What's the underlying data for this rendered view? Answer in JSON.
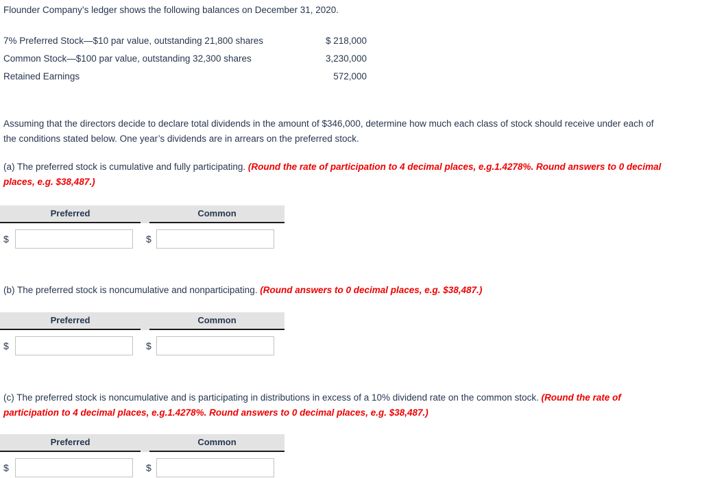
{
  "intro": "Flounder Company’s ledger shows the following balances on December 31, 2020.",
  "ledger": {
    "rows": [
      {
        "label": "7% Preferred Stock—$10 par value, outstanding 21,800 shares",
        "amount": "$ 218,000"
      },
      {
        "label": "Common Stock—$100 par value, outstanding 32,300 shares",
        "amount": "3,230,000"
      },
      {
        "label": "Retained Earnings",
        "amount": "572,000"
      }
    ]
  },
  "assume_paragraph": "Assuming that the directors decide to declare total dividends in the amount of $346,000, determine how much each class of stock should receive under each of the conditions stated below. One year’s dividends are in arrears on the preferred stock.",
  "questions": [
    {
      "letter": "(a)",
      "text": " The preferred stock is cumulative and fully participating. ",
      "hint": "(Round the rate of participation to 4 decimal places, e.g.1.4278%. Round answers to 0 decimal places, e.g. $38,487.)"
    },
    {
      "letter": "(b)",
      "text": " The preferred stock is noncumulative and nonparticipating. ",
      "hint": "(Round answers to 0 decimal places, e.g. $38,487.)"
    },
    {
      "letter": "(c)",
      "text": " The preferred stock is noncumulative and is participating in distributions in excess of a 10% dividend rate on the common stock. ",
      "hint": "(Round the rate of participation to 4 decimal places, e.g.1.4278%. Round answers to 0 decimal places, e.g. $38,487.)"
    }
  ],
  "answer_tables": [
    {
      "id": "a",
      "header_preferred": "Preferred",
      "header_common": "Common",
      "currency_symbol": "$",
      "preferred_value": "",
      "common_value": "",
      "preferred_placeholder": "",
      "common_placeholder": ""
    },
    {
      "id": "b",
      "header_preferred": "Preferred",
      "header_common": "Common",
      "currency_symbol": "$",
      "preferred_value": "",
      "common_value": "",
      "preferred_placeholder": "",
      "common_placeholder": ""
    },
    {
      "id": "c",
      "header_preferred": "Preferred",
      "header_common": "Common",
      "currency_symbol": "$",
      "preferred_value": "",
      "common_value": "",
      "preferred_placeholder": "",
      "common_placeholder": ""
    }
  ],
  "colors": {
    "text": "#27364f",
    "hint_red": "#ed0000",
    "header_background": "#e3e3e3",
    "header_rule": "#1a1a1a",
    "input_border": "#c2c2c2",
    "page_background": "#ffffff"
  }
}
